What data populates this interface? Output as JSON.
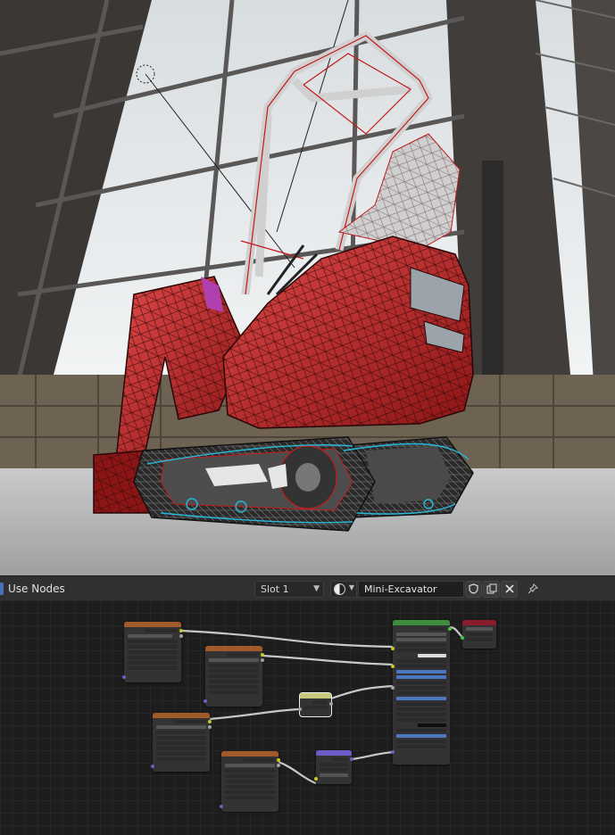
{
  "header": {
    "use_nodes_label": "Use Nodes",
    "slot_label": "Slot 1",
    "material_name": "Mini-Excavator",
    "fake_user_icon": "shield-icon",
    "duplicate_icon": "duplicate-icon",
    "unlink_icon": "close-icon",
    "pin_icon": "pin-icon"
  },
  "colors": {
    "node_image": "#a15a2a",
    "node_bsdf": "#3d8d3d",
    "node_output": "#8a1d2b",
    "node_mix": "#c8c87a",
    "node_normal": "#6b5cc8",
    "accent": "#4772b3"
  }
}
